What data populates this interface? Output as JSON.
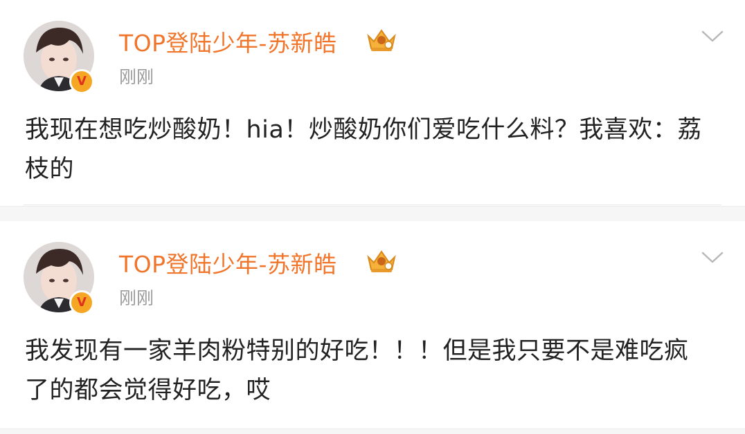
{
  "posts": [
    {
      "author": "TOP登陆少年-苏新皓",
      "timestamp": "刚刚",
      "badge": "crown-vip-icon",
      "text": "我现在想吃炒酸奶！hia！炒酸奶你们爱吃什么料？我喜欢：荔枝的"
    },
    {
      "author": "TOP登陆少年-苏新皓",
      "timestamp": "刚刚",
      "badge": "crown-vip-icon",
      "text": "我发现有一家羊肉粉特别的好吃！！！但是我只要不是难吃疯了的都会觉得好吃，哎"
    }
  ],
  "colors": {
    "username": "#f0752a",
    "timestamp": "#9a9a9a",
    "text": "#222222",
    "verified": "#f5a623"
  }
}
